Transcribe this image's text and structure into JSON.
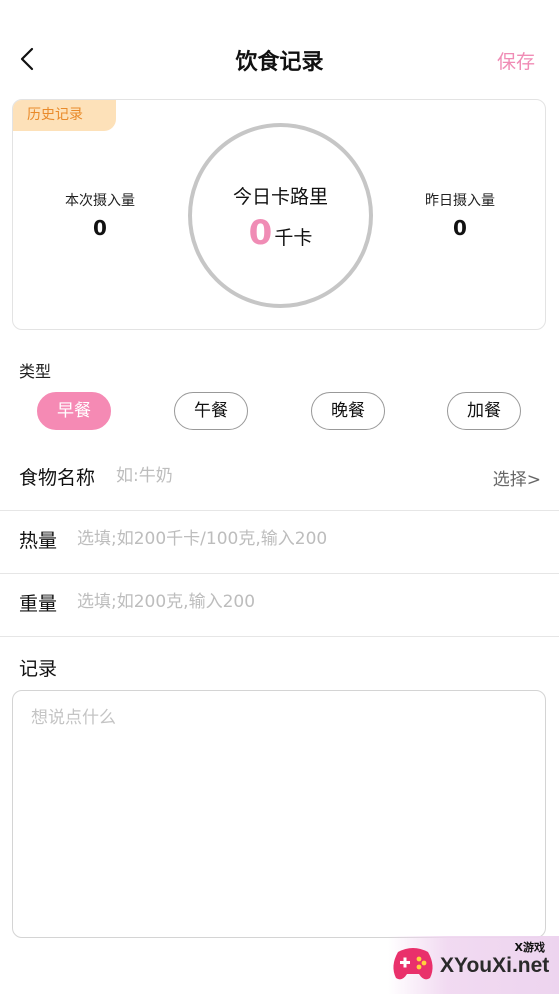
{
  "header": {
    "title": "饮食记录",
    "save_label": "保存",
    "back_icon": "chevron-left-icon"
  },
  "summary": {
    "history_label": "历史记录",
    "current_intake_label": "本次摄入量",
    "current_intake_value": "0",
    "today_label": "今日卡路里",
    "today_value": "0",
    "today_unit": "千卡",
    "yesterday_label": "昨日摄入量",
    "yesterday_value": "0"
  },
  "meal_type": {
    "label": "类型",
    "options": [
      "早餐",
      "午餐",
      "晚餐",
      "加餐"
    ],
    "selected": "早餐"
  },
  "form": {
    "food_name_label": "食物名称",
    "food_name_placeholder": "如:牛奶",
    "choose_label": "选择>",
    "calories_label": "热量",
    "calories_placeholder": "选填;如200千卡/100克,输入200",
    "weight_label": "重量",
    "weight_placeholder": "选填;如200克,输入200",
    "record_label": "记录",
    "record_placeholder": "想说点什么"
  },
  "watermark": {
    "top_text": "X游戏",
    "main_text": "XYouXi.net"
  },
  "colors": {
    "accent_pink": "#f58ab4",
    "save_pink": "#f08cb5",
    "history_tag_bg": "#fde1b9",
    "history_tag_text": "#e98a2a",
    "ring_gray": "#c6c6c6"
  }
}
